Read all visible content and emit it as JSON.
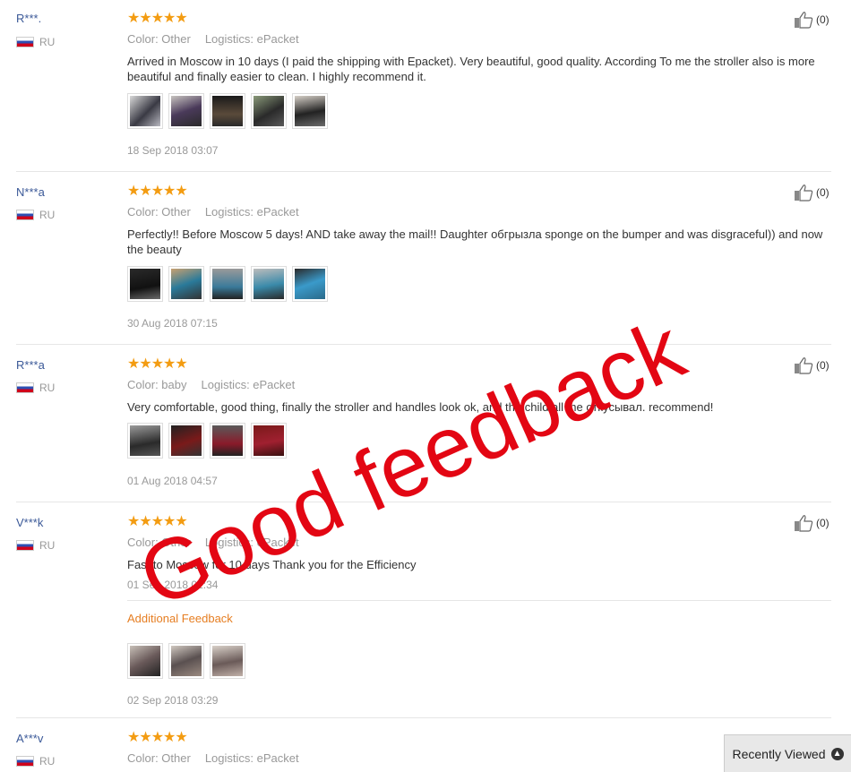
{
  "reviews": [
    {
      "user": "R***.",
      "country": "RU",
      "stars": "★★★★★",
      "color": "Color: Other",
      "logistics": "Logistics: ePacket",
      "text": "Arrived in Moscow in 10 days (I paid the shipping with Epacket). Very beautiful, good quality. According To me the stroller also is more beautiful and finally easier to clean. I highly recommend it.",
      "date": "18 Sep 2018 03:07",
      "likes": "(0)"
    },
    {
      "user": "N***a",
      "country": "RU",
      "stars": "★★★★★",
      "color": "Color: Other",
      "logistics": "Logistics: ePacket",
      "text": "Perfectly!! Before Moscow 5 days! AND take away the mail!! Daughter обгрызла sponge on the bumper and was disgraceful)) and now the beauty",
      "date": "30 Aug 2018 07:15",
      "likes": "(0)"
    },
    {
      "user": "R***a",
      "country": "RU",
      "stars": "★★★★★",
      "color": "Color: baby",
      "logistics": "Logistics: ePacket",
      "text": "Very comfortable, good thing, finally the stroller and handles look ok, and the child all the откусывал. recommend!",
      "date": "01 Aug 2018 04:57",
      "likes": "(0)"
    },
    {
      "user": "V***k",
      "country": "RU",
      "stars": "★★★★★",
      "color": "Color: Other",
      "logistics": "Logistics: ePacket",
      "text": "Fast to Moscow for 10 days Thank you for the Efficiency",
      "date": "01 Sep 2018 02:34",
      "additional_label": "Additional Feedback",
      "additional_date": "02 Sep 2018 03:29",
      "likes": "(0)"
    },
    {
      "user": "A***v",
      "country": "RU",
      "stars": "★★★★★",
      "color": "Color: Other",
      "logistics": "Logistics: ePacket"
    }
  ],
  "overlay_text": "Good feedback",
  "recently_viewed": "Recently Viewed",
  "colors": {
    "star": "#f39c12",
    "overlay": "#e30613",
    "username": "#3b5998",
    "additional": "#e67e22"
  }
}
